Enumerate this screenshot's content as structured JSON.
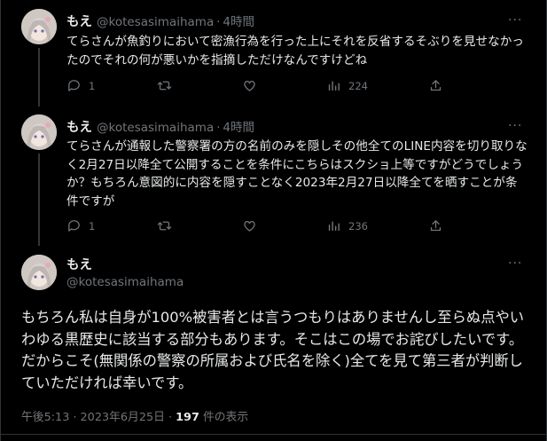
{
  "tweets": [
    {
      "name": "もえ",
      "handle": "@kotesasimaihama",
      "separator": "·",
      "time": "4時間",
      "more": "···",
      "text": "てらさんが魚釣りにおいて密漁行為を行った上にそれを反省するそぶりを見せなかったのでそれの何が悪いかを指摘しただけなんですけどね",
      "replies": "1",
      "retweets": "",
      "likes": "",
      "views": "224"
    },
    {
      "name": "もえ",
      "handle": "@kotesasimaihama",
      "separator": "·",
      "time": "4時間",
      "more": "···",
      "text": "てらさんが通報した警察署の方の名前のみを隠しその他全てのLINE内容を切り取りなく2月27日以降全て公開することを条件にこちらはスクショ上等ですがどうでしょうか？もちろん意図的に内容を隠すことなく2023年2月27日以降全てを晒すことが条件ですが",
      "replies": "1",
      "retweets": "",
      "likes": "",
      "views": "236"
    }
  ],
  "main_tweet": {
    "name": "もえ",
    "handle": "@kotesasimaihama",
    "more": "···",
    "text": "もちろん私は自身が100%被害者とは言うつもりはありませんし至らぬ点やいわゆる黒歴史に該当する部分もあります。そこはこの場でお詫びしたいです。だからこそ(無関係の警察の所属および氏名を除く)全てを見て第三者が判断していただければ幸いです。",
    "timestamp": "午後5:13 · 2023年6月25日 ·",
    "view_count": "197",
    "view_label": "件の表示"
  },
  "colors": {
    "background": "#000000",
    "text": "#e7e9ea",
    "muted": "#71767b",
    "border": "#2f3336"
  }
}
